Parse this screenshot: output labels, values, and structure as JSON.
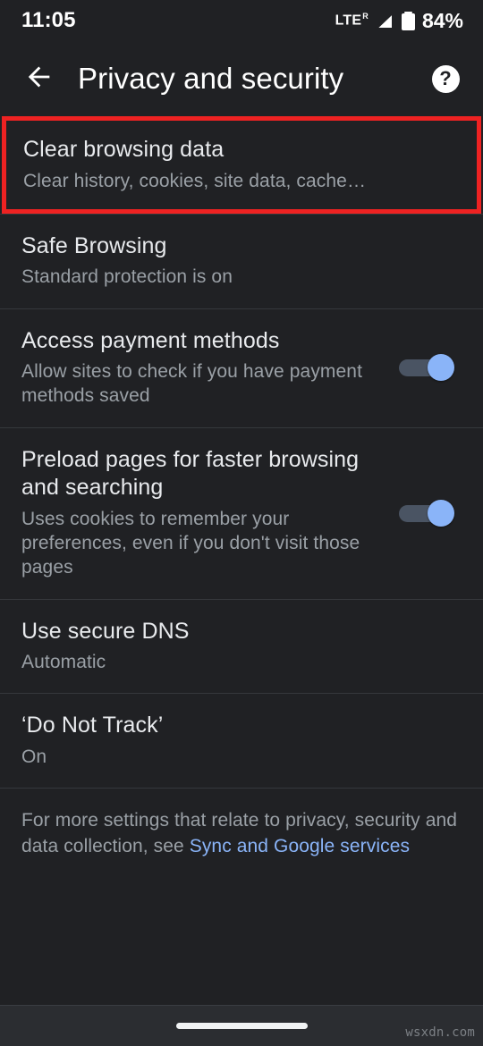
{
  "status_bar": {
    "time": "11:05",
    "network_label": "LTE",
    "network_superscript": "R",
    "signal_icon": "signal-bar-slash-icon",
    "battery_icon": "battery-full-icon",
    "battery_percent": "84%"
  },
  "app_bar": {
    "back_icon": "back-arrow-icon",
    "title": "Privacy and security",
    "help_icon": "help-circle-icon",
    "help_glyph": "?"
  },
  "settings": [
    {
      "name": "clear-browsing-data",
      "title": "Clear browsing data",
      "subtitle": "Clear history, cookies, site data, cache…",
      "toggle": null,
      "highlighted": true
    },
    {
      "name": "safe-browsing",
      "title": "Safe Browsing",
      "subtitle": "Standard protection is on",
      "toggle": null,
      "highlighted": false
    },
    {
      "name": "access-payment-methods",
      "title": "Access payment methods",
      "subtitle": "Allow sites to check if you have payment methods saved",
      "toggle": "on",
      "highlighted": false
    },
    {
      "name": "preload-pages",
      "title": "Preload pages for faster browsing and searching",
      "subtitle": "Uses cookies to remember your preferences, even if you don't visit those pages",
      "toggle": "on",
      "highlighted": false
    },
    {
      "name": "use-secure-dns",
      "title": "Use secure DNS",
      "subtitle": "Automatic",
      "toggle": null,
      "highlighted": false
    },
    {
      "name": "do-not-track",
      "title": "‘Do Not Track’",
      "subtitle": "On",
      "toggle": null,
      "highlighted": false
    }
  ],
  "footer": {
    "text_before_link": "For more settings that relate to privacy, security and data collection, see ",
    "link_text": "Sync and Google services"
  },
  "nav_bar": {
    "home_pill": "home-gesture-pill"
  },
  "watermark": {
    "text": "wsxdn.com"
  },
  "colors": {
    "background": "#202124",
    "divider": "#35383c",
    "primary_text": "#e8eaed",
    "secondary_text": "#9aa0a6",
    "accent_blue": "#8ab4f8",
    "toggle_track": "#4a5463",
    "highlight_red": "#ee2222",
    "nav_bar_bg": "#2b2d31"
  }
}
